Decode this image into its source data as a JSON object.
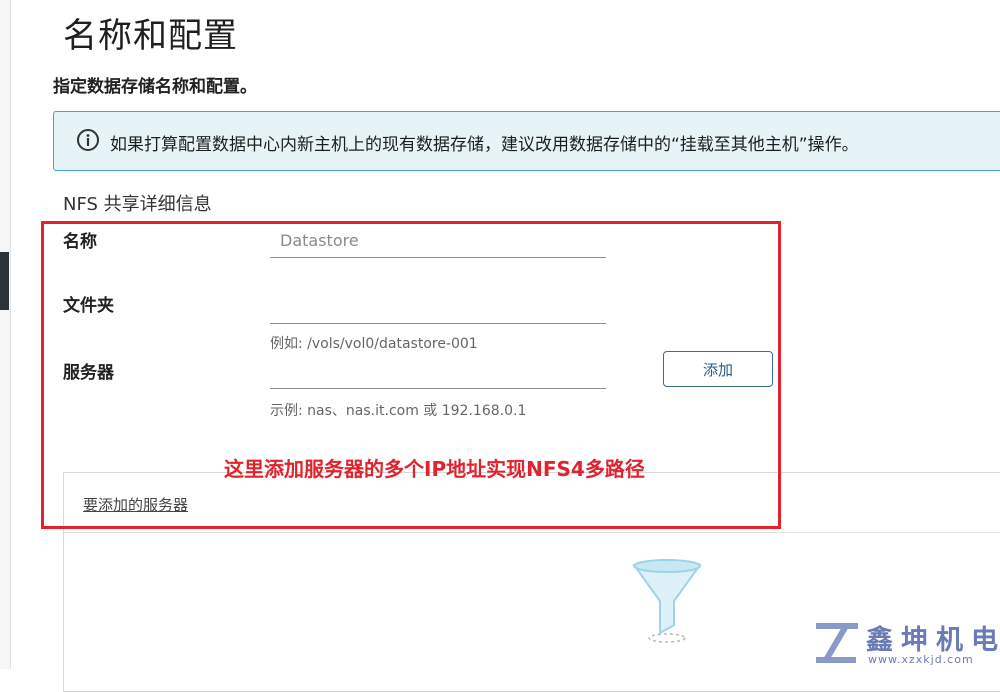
{
  "page": {
    "title": "名称和配置",
    "subtitle": "指定数据存储名称和配置。"
  },
  "info_banner": {
    "icon": "info-icon",
    "text": "如果打算配置数据中心内新主机上的现有数据存储，建议改用数据存储中的“挂载至其他主机”操作。"
  },
  "nfs_section": {
    "title": "NFS 共享详细信息",
    "name_field": {
      "label": "名称",
      "value": "",
      "placeholder": "Datastore"
    },
    "folder_field": {
      "label": "文件夹",
      "value": "",
      "placeholder": "",
      "hint": "例如: /vols/vol0/datastore-001"
    },
    "server_field": {
      "label": "服务器",
      "value": "",
      "placeholder": "",
      "hint": "示例: nas、nas.it.com 或 192.168.0.1"
    },
    "add_button_label": "添加"
  },
  "annotation": {
    "text": "这里添加服务器的多个IP地址实现NFS4多路径",
    "color": "#e0232c"
  },
  "servers_to_add": {
    "title": "要添加的服务器",
    "empty_icon": "funnel-icon"
  },
  "watermark": {
    "logo": "xz-logo",
    "text": "鑫坤机电",
    "url": "www.xzxkjd.com"
  },
  "colors": {
    "accent": "#2a5b82",
    "info_border": "#4aa4c6",
    "info_bg": "#e6f4f8",
    "highlight": "#e0232c"
  }
}
